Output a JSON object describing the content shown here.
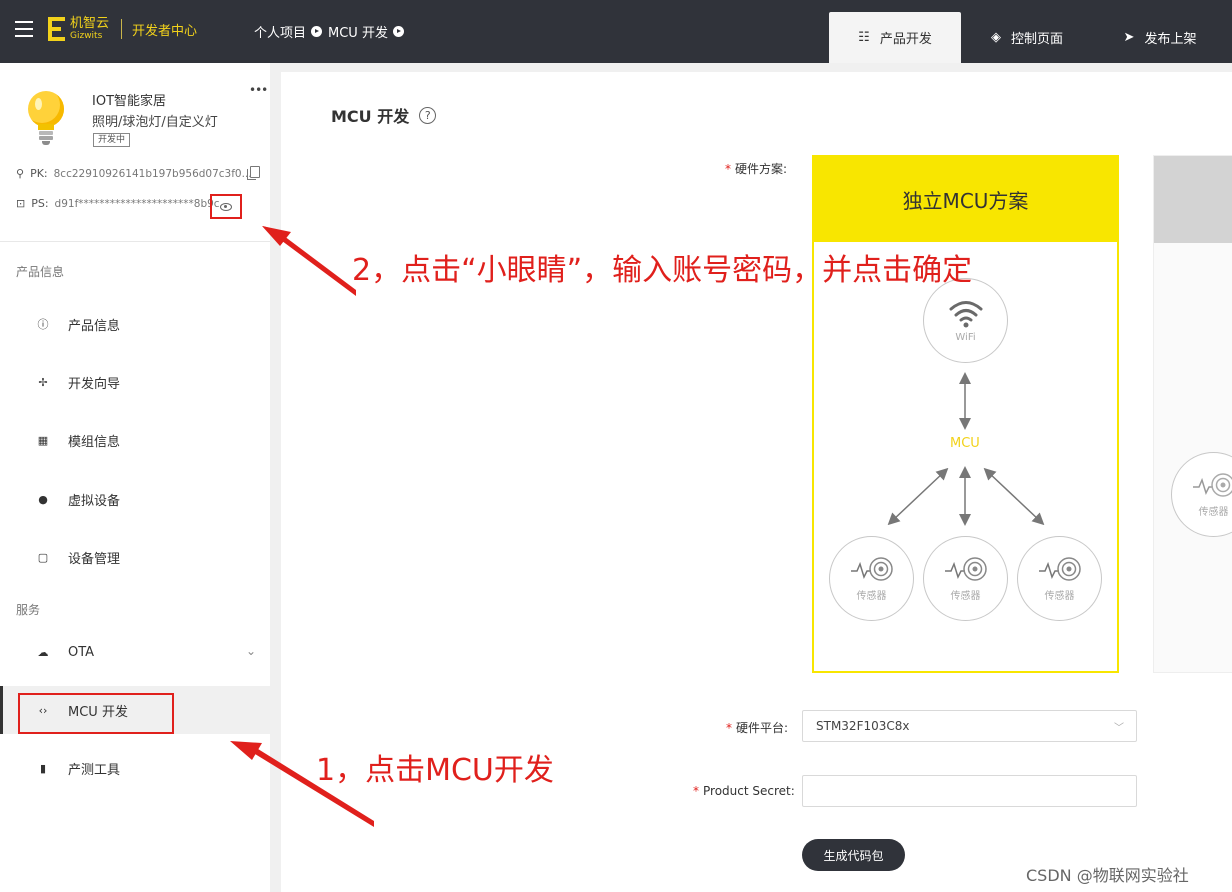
{
  "header": {
    "brand_cn": "机智云",
    "brand_en": "Gizwits",
    "brand_center": "开发者中心",
    "breadcrumb": [
      "个人项目",
      "MCU 开发"
    ],
    "tabs": [
      {
        "label": "产品开发",
        "icon": "sliders-icon",
        "active": true
      },
      {
        "label": "控制页面",
        "icon": "diamond-icon",
        "active": false
      },
      {
        "label": "发布上架",
        "icon": "send-icon",
        "active": false
      }
    ]
  },
  "product": {
    "name": "IOT智能家居",
    "category": "照明/球泡灯/自定义灯",
    "status": "开发中",
    "pk_label": "PK:",
    "pk_value": "8cc22910926141b197b956d07c3f0...",
    "ps_label": "PS:",
    "ps_value": "d91f**********************8b9c"
  },
  "sidebar": {
    "section_product": "产品信息",
    "section_service": "服务",
    "items": [
      {
        "label": "产品信息",
        "icon": "info-icon"
      },
      {
        "label": "开发向导",
        "icon": "signpost-icon"
      },
      {
        "label": "模组信息",
        "icon": "grid-icon"
      },
      {
        "label": "虚拟设备",
        "icon": "globe-icon"
      },
      {
        "label": "设备管理",
        "icon": "clipboard-icon"
      }
    ],
    "service_items": [
      {
        "label": "OTA",
        "icon": "cloud-icon"
      },
      {
        "label": "MCU 开发",
        "icon": "code-icon",
        "active": true
      },
      {
        "label": "产测工具",
        "icon": "test-tube-icon"
      }
    ]
  },
  "main": {
    "title": "MCU 开发",
    "hardware_scheme_label": "硬件方案:",
    "card_title": "独立MCU方案",
    "wifi_label": "WiFi",
    "mcu_label": "MCU",
    "sensor_label": "传感器",
    "hardware_platform_label": "硬件平台:",
    "hardware_platform_value": "STM32F103C8x",
    "product_secret_label": "Product Secret:",
    "product_secret_value": "",
    "generate_button": "生成代码包"
  },
  "annotations": {
    "step1": "1，点击MCU开发",
    "step2": "2，点击“小眼睛”，输入账号密码，并点击确定"
  },
  "colors": {
    "topbar": "#30333a",
    "brand_yellow": "#f2d21b",
    "card_yellow": "#f8e600",
    "annotation_red": "#e0201c"
  },
  "watermark": "CSDN @物联网实验社"
}
